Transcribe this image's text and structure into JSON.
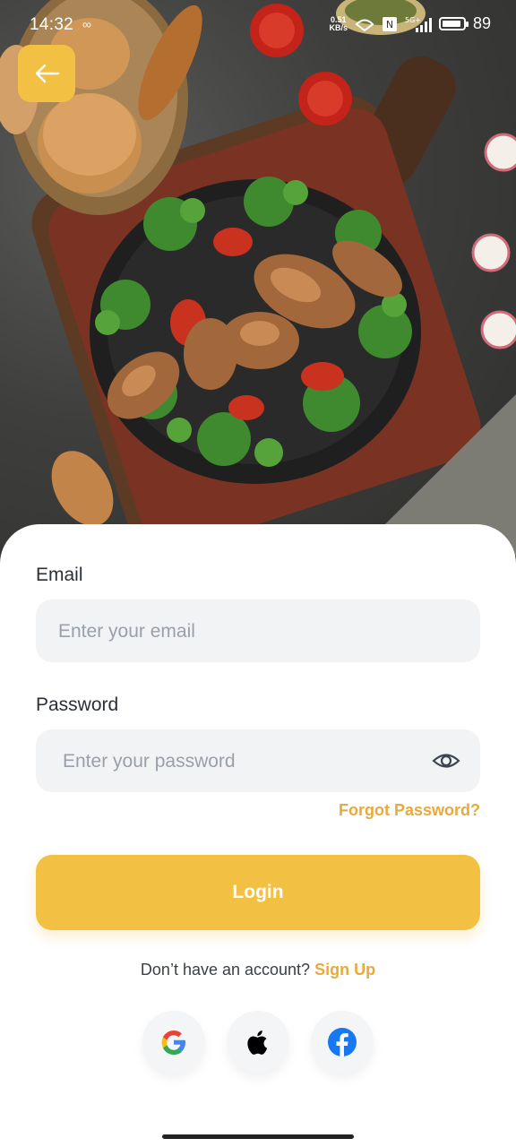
{
  "status_bar": {
    "time": "14:32",
    "net_speed_value": "0.51",
    "net_speed_unit": "KB/s",
    "network": "5G+",
    "battery": "89",
    "battery_level": 0.89
  },
  "form": {
    "email_label": "Email",
    "email_placeholder": "Enter your email",
    "password_label": "Password",
    "password_placeholder": "Enter your password",
    "forgot_password": "Forgot Password?",
    "login_label": "Login"
  },
  "signup": {
    "prompt": "Don’t have an account?",
    "link": "Sign Up"
  },
  "social": [
    "google-icon",
    "apple-icon",
    "facebook-icon"
  ],
  "colors": {
    "accent": "#f2c144",
    "link": "#e9a93b",
    "input_bg": "#f2f3f5"
  }
}
